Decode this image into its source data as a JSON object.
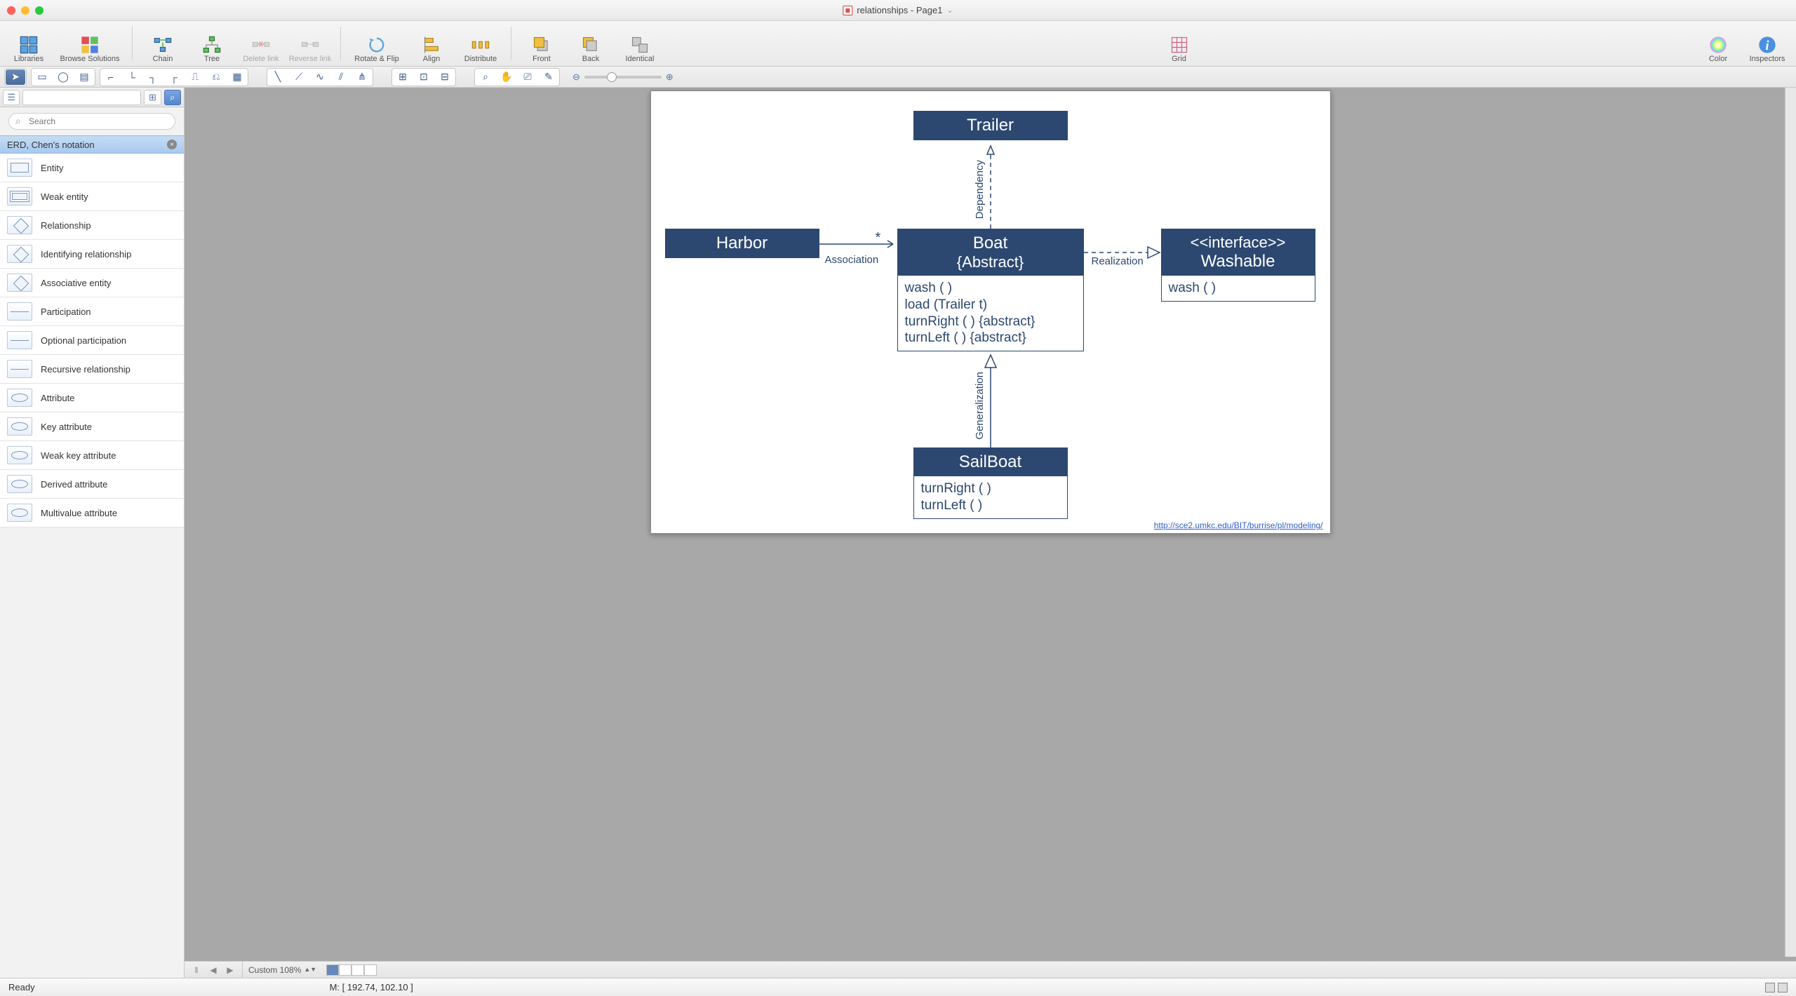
{
  "window": {
    "title": "relationships - Page1"
  },
  "toolbar": {
    "libraries": "Libraries",
    "browse": "Browse Solutions",
    "chain": "Chain",
    "tree": "Tree",
    "deleteLink": "Delete link",
    "reverseLink": "Reverse link",
    "rotateFlip": "Rotate & Flip",
    "align": "Align",
    "distribute": "Distribute",
    "front": "Front",
    "back": "Back",
    "identical": "Identical",
    "grid": "Grid",
    "color": "Color",
    "inspectors": "Inspectors"
  },
  "sidebar": {
    "searchPlaceholder": "Search",
    "section": "ERD, Chen's notation",
    "items": [
      {
        "label": "Entity",
        "th": "rect"
      },
      {
        "label": "Weak entity",
        "th": "drect"
      },
      {
        "label": "Relationship",
        "th": "diam"
      },
      {
        "label": "Identifying relationship",
        "th": "diam"
      },
      {
        "label": "Associative entity",
        "th": "diam"
      },
      {
        "label": "Participation",
        "th": "line"
      },
      {
        "label": "Optional participation",
        "th": "line"
      },
      {
        "label": "Recursive relationship",
        "th": "line"
      },
      {
        "label": "Attribute",
        "th": "oval"
      },
      {
        "label": "Key attribute",
        "th": "oval"
      },
      {
        "label": "Weak key attribute",
        "th": "oval"
      },
      {
        "label": "Derived attribute",
        "th": "oval"
      },
      {
        "label": "Multivalue attribute",
        "th": "oval"
      }
    ]
  },
  "diagram": {
    "trailer": "Trailer",
    "harbor": "Harbor",
    "boat_title": "Boat",
    "boat_sub": "{Abstract}",
    "boat_ops": [
      "wash ( )",
      "load (Trailer t)",
      "turnRight ( ) {abstract}",
      "turnLeft ( ) {abstract}"
    ],
    "iface_stereo": "<<interface>>",
    "iface_name": "Washable",
    "iface_ops": [
      "wash ( )"
    ],
    "sailboat": "SailBoat",
    "sailboat_ops": [
      "turnRight ( )",
      "turnLeft ( )"
    ],
    "assoc": "Association",
    "assoc_mult": "*",
    "dep": "Dependency",
    "real": "Realization",
    "gen": "Generalization",
    "link": "http://sce2.umkc.edu/BIT/burrise/pl/modeling/"
  },
  "bottom": {
    "zoom": "Custom 108%"
  },
  "status": {
    "ready": "Ready",
    "coords": "M: [ 192.74, 102.10 ]"
  }
}
